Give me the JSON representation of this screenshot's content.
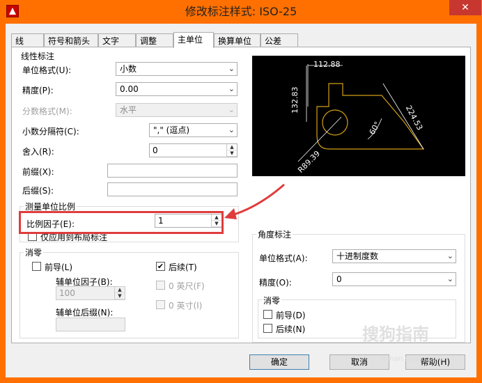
{
  "window": {
    "title": "修改标注样式: ISO-25",
    "close": "✕"
  },
  "tabs": [
    "线",
    "符号和箭头",
    "文字",
    "调整",
    "主单位",
    "换算单位",
    "公差"
  ],
  "linear": {
    "group_label": "线性标注",
    "unit_format_label": "单位格式(U):",
    "unit_format_value": "小数",
    "precision_label": "精度(P):",
    "precision_value": "0.00",
    "fraction_label": "分数格式(M):",
    "fraction_value": "水平",
    "decimal_sep_label": "小数分隔符(C):",
    "decimal_sep_value": "\",\" (逗点)",
    "round_label": "舍入(R):",
    "round_value": "0",
    "prefix_label": "前缀(X):",
    "prefix_value": "",
    "suffix_label": "后缀(S):",
    "suffix_value": ""
  },
  "scale": {
    "group_label": "测量单位比例",
    "factor_label": "比例因子(E):",
    "factor_value": "1",
    "layout_only_label": "仅应用到布局标注"
  },
  "zero": {
    "group_label": "消零",
    "leading_label": "前导(L)",
    "trailing_label": "后续(T)",
    "sub_factor_label": "辅单位因子(B):",
    "sub_factor_value": "100",
    "sub_suffix_label": "辅单位后缀(N):",
    "sub_suffix_value": "",
    "feet_label": "0 英尺(F)",
    "inches_label": "0 英寸(I)"
  },
  "angular": {
    "group_label": "角度标注",
    "unit_format_label": "单位格式(A):",
    "unit_format_value": "十进制度数",
    "precision_label": "精度(O):",
    "precision_value": "0",
    "zero_group_label": "消零",
    "leading_label": "前导(D)",
    "trailing_label": "后续(N)"
  },
  "preview": {
    "dim_top": "112.88",
    "dim_left": "132.83",
    "dim_right": "224.53",
    "dim_angle": "60°",
    "dim_radius": "R89.39"
  },
  "buttons": {
    "ok": "确定",
    "cancel": "取消",
    "help": "帮助(H)"
  },
  "watermark": {
    "text": "搜狗指南",
    "sub": "zhinan.sogou.com"
  },
  "colors": {
    "titlebar": "#ff7000",
    "highlight": "#e03c3c",
    "preview_bg": "#000000"
  }
}
